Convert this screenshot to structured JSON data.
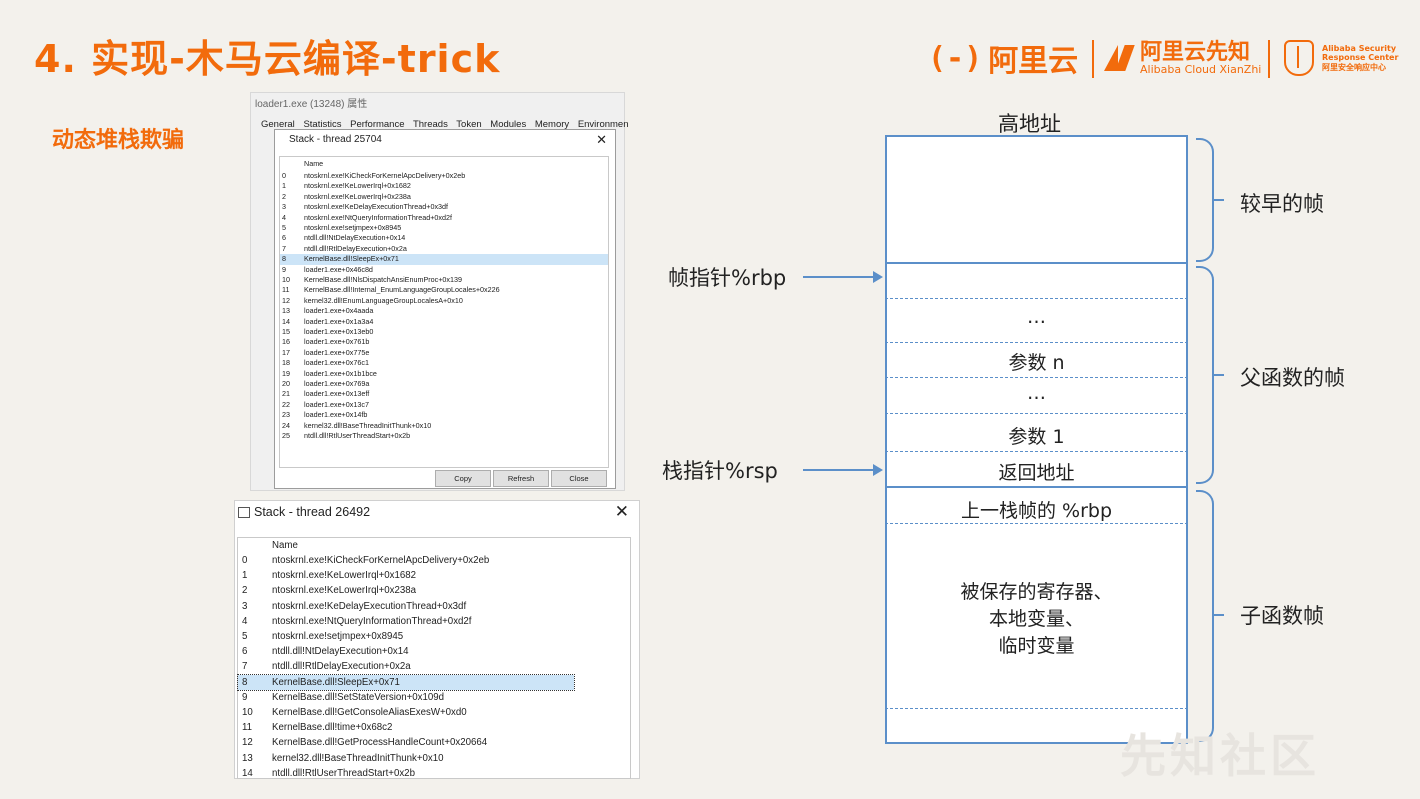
{
  "slide": {
    "title": "4. 实现-木马云编译-trick",
    "subtitle": "动态堆栈欺骗",
    "watermark": "先知社区"
  },
  "logos": {
    "aliyun": "阿里云",
    "xianzhi_cn": "阿里云先知",
    "xianzhi_en": "Alibaba Cloud XianZhi",
    "asrc_line1": "Alibaba Security",
    "asrc_line2": "Response Center",
    "asrc_line3": "阿里安全响应中心"
  },
  "window1": {
    "title": "loader1.exe (13248) 属性",
    "tabs": [
      "General",
      "Statistics",
      "Performance",
      "Threads",
      "Token",
      "Modules",
      "Memory",
      "Environmen"
    ],
    "dialog_title": "Stack - thread 25704",
    "column": "Name",
    "rows": [
      {
        "n": "0",
        "v": "ntoskrnl.exe!KiCheckForKernelApcDelivery+0x2eb"
      },
      {
        "n": "1",
        "v": "ntoskrnl.exe!KeLowerIrql+0x1682"
      },
      {
        "n": "2",
        "v": "ntoskrnl.exe!KeLowerIrql+0x238a"
      },
      {
        "n": "3",
        "v": "ntoskrnl.exe!KeDelayExecutionThread+0x3df"
      },
      {
        "n": "4",
        "v": "ntoskrnl.exe!NtQueryInformationThread+0xd2f"
      },
      {
        "n": "5",
        "v": "ntoskrnl.exe!setjmpex+0x8945"
      },
      {
        "n": "6",
        "v": "ntdll.dll!NtDelayExecution+0x14"
      },
      {
        "n": "7",
        "v": "ntdll.dll!RtlDelayExecution+0x2a"
      },
      {
        "n": "8",
        "v": "KernelBase.dll!SleepEx+0x71"
      },
      {
        "n": "9",
        "v": "loader1.exe+0x46c8d"
      },
      {
        "n": "10",
        "v": "KernelBase.dll!NlsDispatchAnsiEnumProc+0x139"
      },
      {
        "n": "11",
        "v": "KernelBase.dll!Internal_EnumLanguageGroupLocales+0x226"
      },
      {
        "n": "12",
        "v": "kernel32.dll!EnumLanguageGroupLocalesA+0x10"
      },
      {
        "n": "13",
        "v": "loader1.exe+0x4aada"
      },
      {
        "n": "14",
        "v": "loader1.exe+0x1a3a4"
      },
      {
        "n": "15",
        "v": "loader1.exe+0x13eb0"
      },
      {
        "n": "16",
        "v": "loader1.exe+0x761b"
      },
      {
        "n": "17",
        "v": "loader1.exe+0x775e"
      },
      {
        "n": "18",
        "v": "loader1.exe+0x76c1"
      },
      {
        "n": "19",
        "v": "loader1.exe+0x1b1bce"
      },
      {
        "n": "20",
        "v": "loader1.exe+0x769a"
      },
      {
        "n": "21",
        "v": "loader1.exe+0x13eff"
      },
      {
        "n": "22",
        "v": "loader1.exe+0x13c7"
      },
      {
        "n": "23",
        "v": "loader1.exe+0x14fb"
      },
      {
        "n": "24",
        "v": "kernel32.dll!BaseThreadInitThunk+0x10"
      },
      {
        "n": "25",
        "v": "ntdll.dll!RtlUserThreadStart+0x2b"
      }
    ],
    "buttons": {
      "copy": "Copy",
      "refresh": "Refresh",
      "close": "Close"
    }
  },
  "window2": {
    "dialog_title": "Stack - thread 26492",
    "column": "Name",
    "rows": [
      {
        "n": "0",
        "v": "ntoskrnl.exe!KiCheckForKernelApcDelivery+0x2eb"
      },
      {
        "n": "1",
        "v": "ntoskrnl.exe!KeLowerIrql+0x1682"
      },
      {
        "n": "2",
        "v": "ntoskrnl.exe!KeLowerIrql+0x238a"
      },
      {
        "n": "3",
        "v": "ntoskrnl.exe!KeDelayExecutionThread+0x3df"
      },
      {
        "n": "4",
        "v": "ntoskrnl.exe!NtQueryInformationThread+0xd2f"
      },
      {
        "n": "5",
        "v": "ntoskrnl.exe!setjmpex+0x8945"
      },
      {
        "n": "6",
        "v": "ntdll.dll!NtDelayExecution+0x14"
      },
      {
        "n": "7",
        "v": "ntdll.dll!RtlDelayExecution+0x2a"
      },
      {
        "n": "8",
        "v": "KernelBase.dll!SleepEx+0x71"
      },
      {
        "n": "9",
        "v": "KernelBase.dll!SetStateVersion+0x109d"
      },
      {
        "n": "10",
        "v": "KernelBase.dll!GetConsoleAliasExesW+0xd0"
      },
      {
        "n": "11",
        "v": "KernelBase.dll!time+0x68c2"
      },
      {
        "n": "12",
        "v": "KernelBase.dll!GetProcessHandleCount+0x20664"
      },
      {
        "n": "13",
        "v": "kernel32.dll!BaseThreadInitThunk+0x10"
      },
      {
        "n": "14",
        "v": "ntdll.dll!RtlUserThreadStart+0x2b"
      }
    ]
  },
  "diagram": {
    "high_addr": "高地址",
    "frame_ptr": "帧指针%rbp",
    "stack_ptr": "栈指针%rsp",
    "cells": {
      "dots1": "…",
      "param_n": "参数 n",
      "dots2": "…",
      "param_1": "参数 1",
      "ret_addr": "返回地址",
      "prev_rbp": "上一栈帧的 %rbp",
      "saved_1": "被保存的寄存器、",
      "saved_2": "本地变量、",
      "saved_3": "临时变量"
    },
    "braces": {
      "earlier": "较早的帧",
      "parent": "父函数的帧",
      "child": "子函数帧"
    }
  }
}
